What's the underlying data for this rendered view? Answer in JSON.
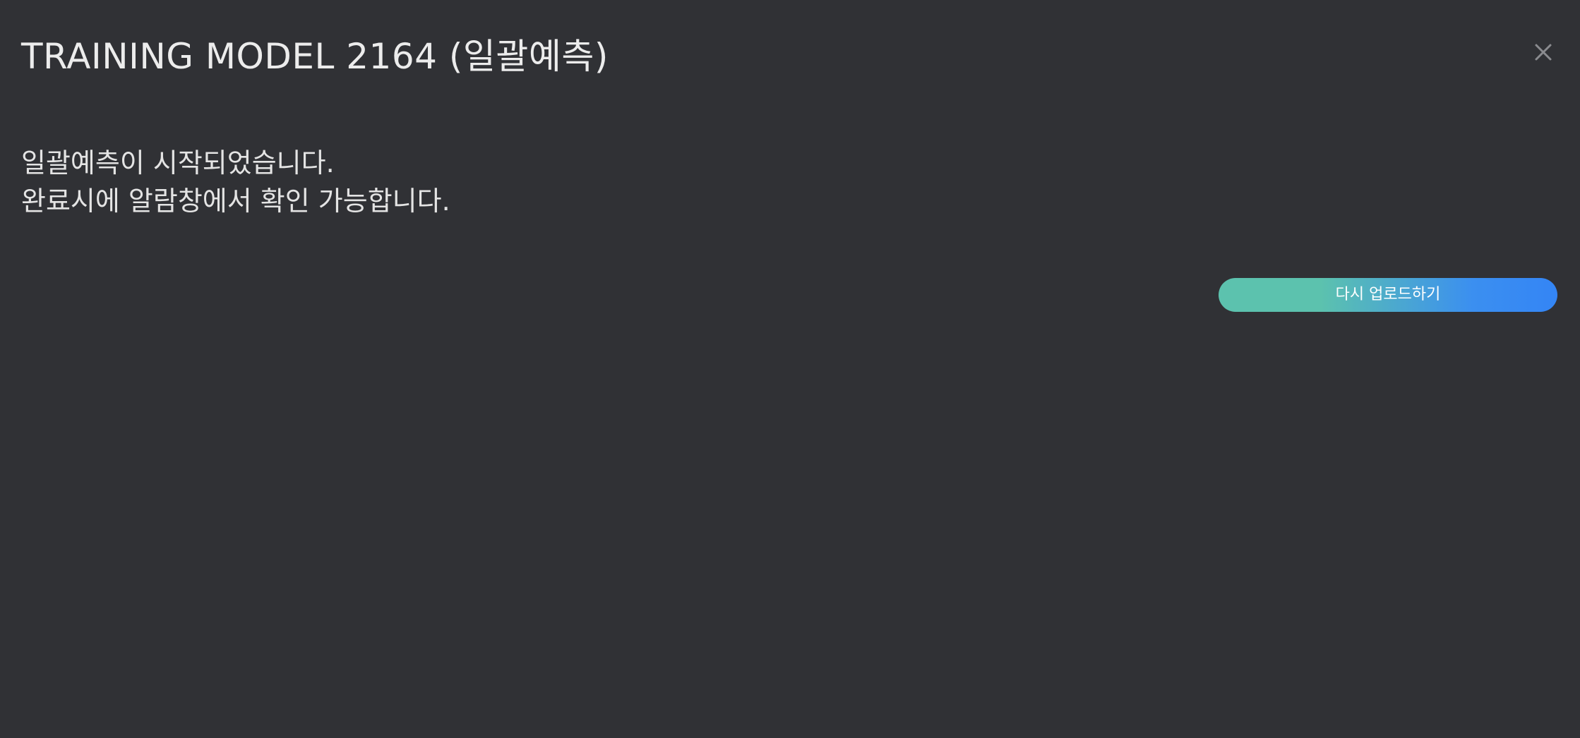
{
  "dialog": {
    "title": "TRAINING MODEL 2164 (일괄예측)",
    "close_icon": "close-icon",
    "message_lines": [
      "일괄예측이 시작되었습니다.",
      "완료시에 알람창에서 확인 가능합니다."
    ],
    "reupload_label": "다시 업로드하기"
  },
  "colors": {
    "background": "#303135",
    "title_text": "#ececec",
    "body_text": "#e4e4e4",
    "close_icon": "#8a8b8f",
    "button_gradient_start": "#5cc2ae",
    "button_gradient_end": "#3485f5",
    "button_text": "#ffffff"
  }
}
